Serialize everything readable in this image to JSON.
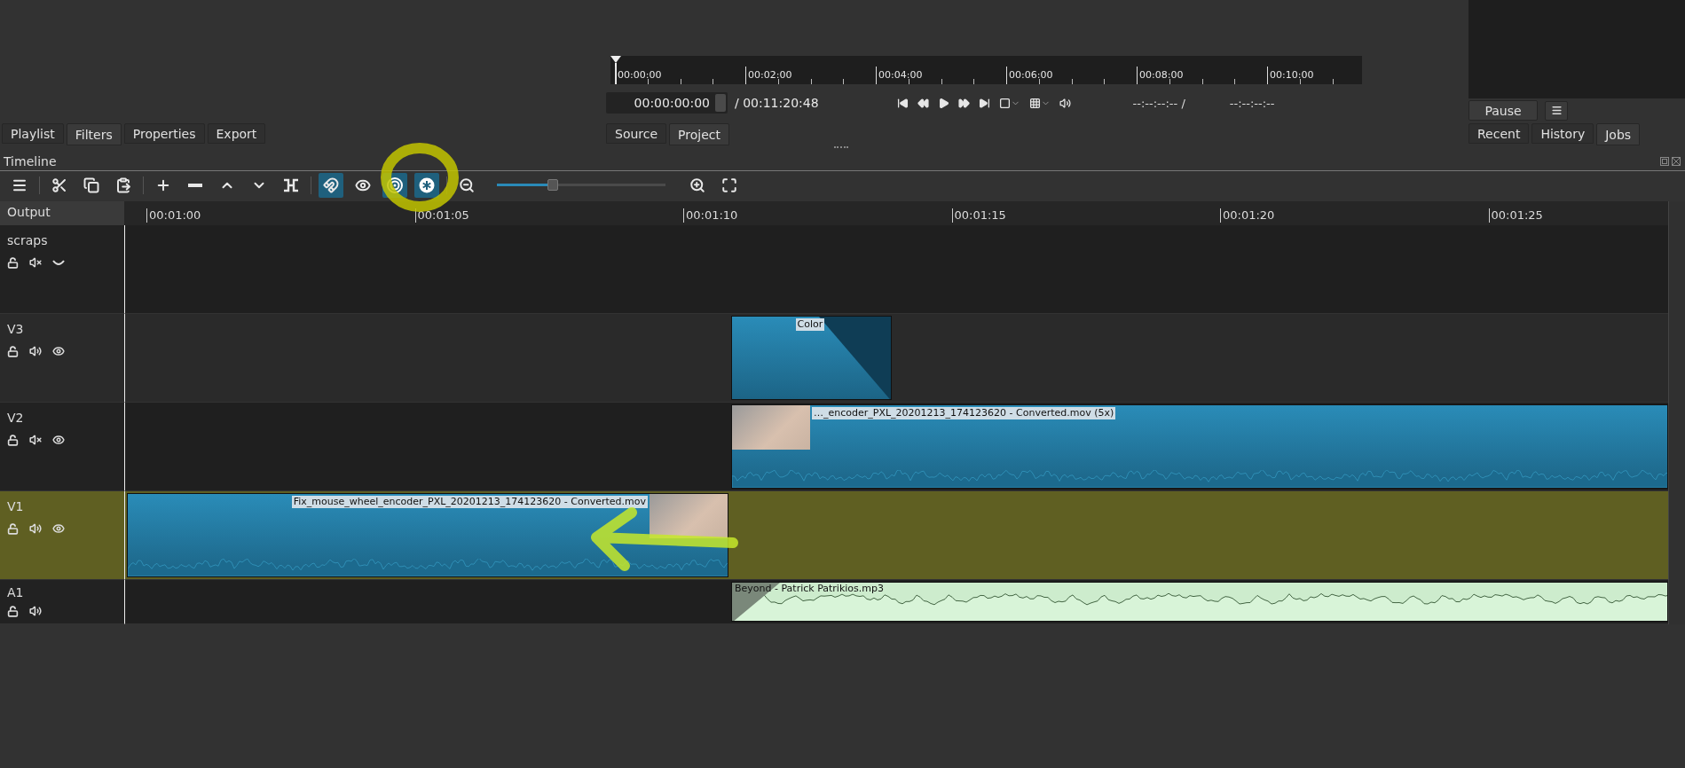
{
  "left_tabs": [
    {
      "label": "Playlist",
      "selected": false
    },
    {
      "label": "Filters",
      "selected": true
    },
    {
      "label": "Properties",
      "selected": false
    },
    {
      "label": "Export",
      "selected": false
    }
  ],
  "preview": {
    "ruler_labels": [
      "00:00:00",
      "00:02:00",
      "00:04:00",
      "00:06:00",
      "00:08:00",
      "00:10:00"
    ],
    "timecode": "00:00:00:00",
    "duration": "/ 00:11:20:48",
    "transport": [
      {
        "kind": "skip-start"
      },
      {
        "kind": "rewind"
      },
      {
        "kind": "play"
      },
      {
        "kind": "fast-forward"
      },
      {
        "kind": "skip-end"
      },
      {
        "kind": "zoom"
      },
      {
        "kind": "grid"
      },
      {
        "kind": "volume"
      }
    ],
    "in_point": "--:--:--:-- /",
    "out_point": "--:--:--:--",
    "tabs": [
      {
        "label": "Source",
        "selected": false
      },
      {
        "label": "Project",
        "selected": true
      }
    ]
  },
  "jobs": {
    "pause_button": "Pause",
    "tabs": [
      {
        "label": "Recent",
        "selected": false
      },
      {
        "label": "History",
        "selected": false
      },
      {
        "label": "Jobs",
        "selected": true
      }
    ]
  },
  "timeline": {
    "title": "Timeline",
    "toolbar": [
      {
        "kind": "menu"
      },
      {
        "kind": "cut"
      },
      {
        "kind": "copy"
      },
      {
        "kind": "paste"
      },
      {
        "kind": "append"
      },
      {
        "kind": "remove"
      },
      {
        "kind": "lift"
      },
      {
        "kind": "overwrite"
      },
      {
        "kind": "split"
      },
      {
        "kind": "snap",
        "checked": true
      },
      {
        "kind": "scrub"
      },
      {
        "kind": "ripple",
        "checked": true
      },
      {
        "kind": "ripple-all",
        "checked": true
      },
      {
        "kind": "zoom-out"
      },
      {
        "kind": "zoom-slider",
        "level": 0.33
      },
      {
        "kind": "zoom-in"
      },
      {
        "kind": "zoom-fit"
      }
    ],
    "output_label": "Output",
    "ruler_labels": [
      "00:01:00",
      "00:01:05",
      "00:01:10",
      "00:01:15",
      "00:01:20",
      "00:01:25"
    ],
    "tracks": [
      {
        "name": "scraps",
        "kind": "video",
        "locked": false,
        "muted": true,
        "hidden": true,
        "selected": false
      },
      {
        "name": "V3",
        "kind": "video",
        "locked": false,
        "muted": false,
        "hidden": false,
        "selected": false,
        "clips": [
          {
            "kind": "color",
            "label": "Color"
          }
        ]
      },
      {
        "name": "V2",
        "kind": "video",
        "locked": false,
        "muted": true,
        "hidden": false,
        "selected": false,
        "clips": [
          {
            "kind": "video",
            "label": "…_encoder_PXL_20201213_174123620 - Converted.mov (5x)"
          }
        ]
      },
      {
        "name": "V1",
        "kind": "video",
        "locked": false,
        "muted": false,
        "hidden": false,
        "selected": true,
        "clips": [
          {
            "kind": "video",
            "label": "Fix_mouse_wheel_encoder_PXL_20201213_174123620 - Converted.mov"
          }
        ]
      },
      {
        "name": "A1",
        "kind": "audio",
        "locked": false,
        "muted": false,
        "selected": false,
        "clips": [
          {
            "kind": "audio",
            "label": "Beyond - Patrick Patrikios.mp3"
          }
        ]
      }
    ]
  }
}
